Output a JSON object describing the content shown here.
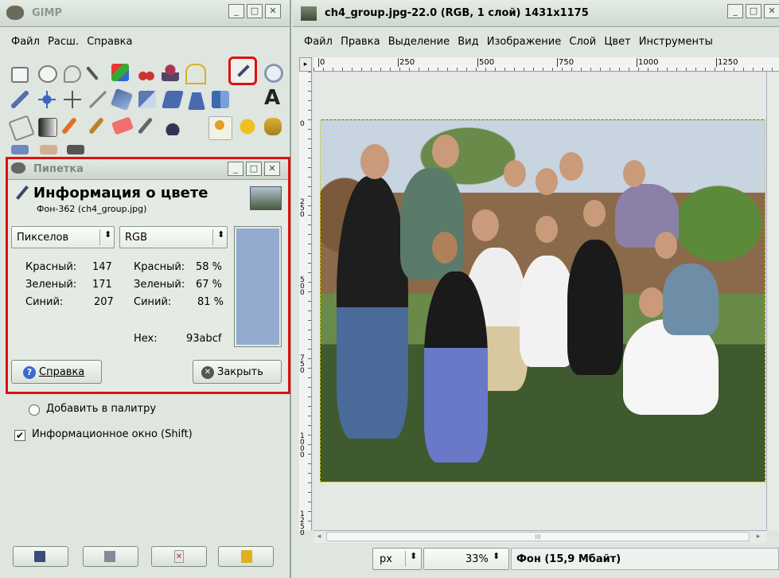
{
  "toolbox": {
    "title": "GIMP",
    "menu": [
      "Файл",
      "Расш.",
      "Справка"
    ],
    "bottom_icons": [
      "save-icon",
      "restore-icon",
      "delete-icon",
      "reset-icon"
    ]
  },
  "color_picker": {
    "title": "Пипетка",
    "heading": "Информация о цвете",
    "subheading": "Фон-362 (ch4_group.jpg)",
    "mode_left": "Пикселов",
    "mode_right": "RGB",
    "left_rows": [
      {
        "label": "Красный:",
        "value": "147"
      },
      {
        "label": "Зеленый:",
        "value": "171"
      },
      {
        "label": "Синий:",
        "value": "207"
      }
    ],
    "right_rows": [
      {
        "label": "Красный:",
        "value": "58 %"
      },
      {
        "label": "Зеленый:",
        "value": "67 %"
      },
      {
        "label": "Синий:",
        "value": "81 %"
      }
    ],
    "hex_label": "Hex:",
    "hex_value": "93abcf",
    "swatch_color": "#93abcf",
    "help_button": "Справка",
    "close_button": "Закрыть"
  },
  "tool_options": {
    "add_to_palette": "Добавить в палитру",
    "info_window": "Информационное окно (Shift)"
  },
  "image_window": {
    "title": "ch4_group.jpg-22.0 (RGB, 1 слой) 1431x1175",
    "menu": [
      "Файл",
      "Правка",
      "Выделение",
      "Вид",
      "Изображение",
      "Слой",
      "Цвет",
      "Инструменты"
    ],
    "ruler_h": [
      "0",
      "250",
      "500",
      "750",
      "1000",
      "1250"
    ],
    "ruler_v": [
      "0",
      "250",
      "500",
      "750",
      "1000",
      "1250"
    ],
    "unit": "px",
    "zoom": "33%",
    "status": "Фон (15,9 Мбайт)",
    "scroll_mark": "III"
  },
  "colors": {
    "highlight": "#e01010",
    "window_bg": "#dfe6e0",
    "picker_title": "#7c8a7c"
  }
}
